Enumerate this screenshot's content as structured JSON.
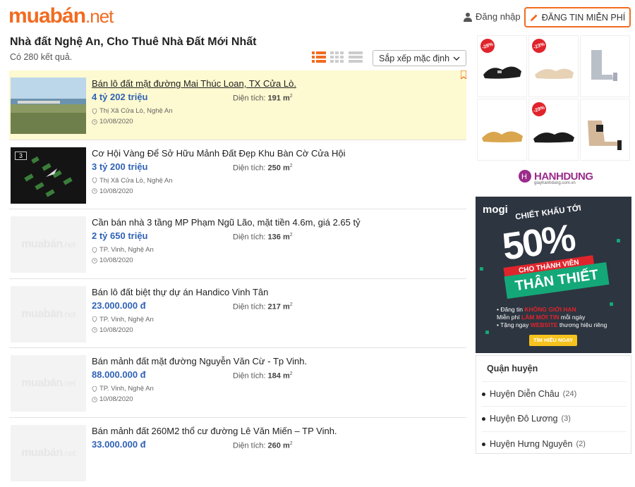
{
  "header": {
    "logo_main": "muabán",
    "logo_tld": ".net",
    "login": "Đăng nhập",
    "post_button": "ĐĂNG TIN MIỄN PHÍ"
  },
  "page": {
    "title": "Nhà đất Nghệ An, Cho Thuê Nhà Đất Mới Nhất",
    "result_count": "Có 280 kết quả.",
    "sort_label": "Sắp xếp mặc định"
  },
  "listings": [
    {
      "title": "Bán lô đất mặt đường Mai Thúc Loan, TX Cửa Lò.",
      "price": "4 tỷ 202 triệu",
      "area_label": "Diện tích:",
      "area": "191 m",
      "area_sup": "2",
      "location": "Thị Xã Cửa Lò, Nghệ An",
      "date": "10/08/2020",
      "photos": ""
    },
    {
      "title": "Cơ Hội Vàng Để Sở Hữu Mảnh Đất Đẹp Khu Bàn Cờ Cửa Hội",
      "price": "3 tỷ 200 triệu",
      "area_label": "Diện tích:",
      "area": "250 m",
      "area_sup": "2",
      "location": "Thị Xã Cửa Lò, Nghệ An",
      "date": "10/08/2020",
      "photos": "3"
    },
    {
      "title": "Cần bán nhà 3 tầng MP Phạm Ngũ Lão, mặt tiền 4.6m, giá 2.65 tỷ",
      "price": "2 tỷ 650 triệu",
      "area_label": "Diện tích:",
      "area": "136 m",
      "area_sup": "2",
      "location": "TP. Vinh, Nghệ An",
      "date": "10/08/2020",
      "photos": ""
    },
    {
      "title": "Bán lô đất biệt thự dự án Handico Vinh Tân",
      "price": "23.000.000 đ",
      "area_label": "Diện tích:",
      "area": "217 m",
      "area_sup": "2",
      "location": "TP. Vinh, Nghệ An",
      "date": "10/08/2020",
      "photos": ""
    },
    {
      "title": "Bán mảnh đất mặt đường Nguyễn Văn Cừ - Tp Vinh.",
      "price": "88.000.000 đ",
      "area_label": "Diện tích:",
      "area": "184 m",
      "area_sup": "2",
      "location": "TP. Vinh, Nghệ An",
      "date": "10/08/2020",
      "photos": ""
    },
    {
      "title": "Bán mảnh đất 260M2 thổ cư đường Lê Văn Miến – TP Vinh.",
      "price": "33.000.000 đ",
      "area_label": "Diện tích:",
      "area": "260 m",
      "area_sup": "2",
      "location": "",
      "date": "",
      "photos": ""
    }
  ],
  "placeholder_logo": {
    "main": "muabán",
    "tld": ".net"
  },
  "ad_shoes": {
    "badges": [
      "-28%",
      "-23%",
      "-29%"
    ],
    "brand": "HANHDUNG",
    "site": "giayhanhdung.com.vn"
  },
  "ad_mogi": {
    "logo": "mogi",
    "line1": "CHIẾT KHẤU TỚI",
    "big": "50%",
    "ribbon1": "CHO THÀNH VIÊN",
    "ribbon2": "THÂN THIẾT",
    "b1_pre": "• Đăng tin ",
    "b1_red": "KHÔNG GIỚI HẠN",
    "b2_pre": "  Miễn phí ",
    "b2_red": "LÀM MỚI TIN",
    "b2_post": " mỗi ngày",
    "b3_pre": "• Tặng ngay ",
    "b3_red": "WEBSITE",
    "b3_post": " thương hiệu riêng",
    "cta": "TÌM HIỂU NGAY"
  },
  "district": {
    "heading": "Quận huyện",
    "items": [
      {
        "name": "Huyện Diễn Châu",
        "count": "(24)"
      },
      {
        "name": "Huyện Đô Lương",
        "count": "(3)"
      },
      {
        "name": "Huyện Hưng Nguyên",
        "count": "(2)"
      }
    ]
  },
  "colors": {
    "brand": "#f26b21",
    "price": "#2f62b6",
    "highlight": "#fdf9d0"
  }
}
